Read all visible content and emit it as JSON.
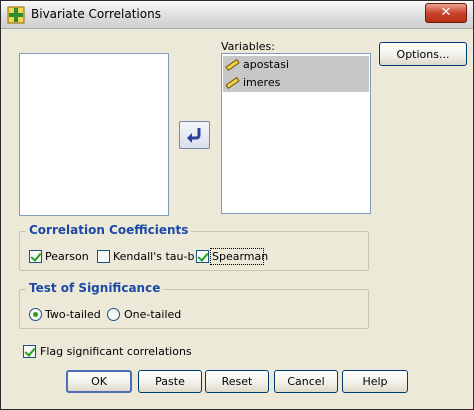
{
  "window": {
    "title": "Bivariate Correlations",
    "close_label": "✕"
  },
  "source_list": {
    "items": []
  },
  "variables": {
    "label": "Variables:",
    "items": [
      "apostasi",
      "imeres"
    ]
  },
  "options_button": "Options...",
  "coefficients": {
    "title": "Correlation Coefficients",
    "pearson": {
      "label": "Pearson",
      "checked": true
    },
    "kendall": {
      "label": "Kendall's tau-b",
      "checked": false
    },
    "spearman": {
      "label": "Spearman",
      "checked": true
    }
  },
  "significance": {
    "title": "Test of Significance",
    "two_tailed": {
      "label": "Two-tailed",
      "selected": true
    },
    "one_tailed": {
      "label": "One-tailed",
      "selected": false
    }
  },
  "flag": {
    "label": "Flag significant correlations",
    "checked": true
  },
  "buttons": {
    "ok": "OK",
    "paste": "Paste",
    "reset": "Reset",
    "cancel": "Cancel",
    "help": "Help"
  },
  "colors": {
    "group_title": "#1c4aa6",
    "selection": "#c7c7c7",
    "check": "#21a121"
  }
}
